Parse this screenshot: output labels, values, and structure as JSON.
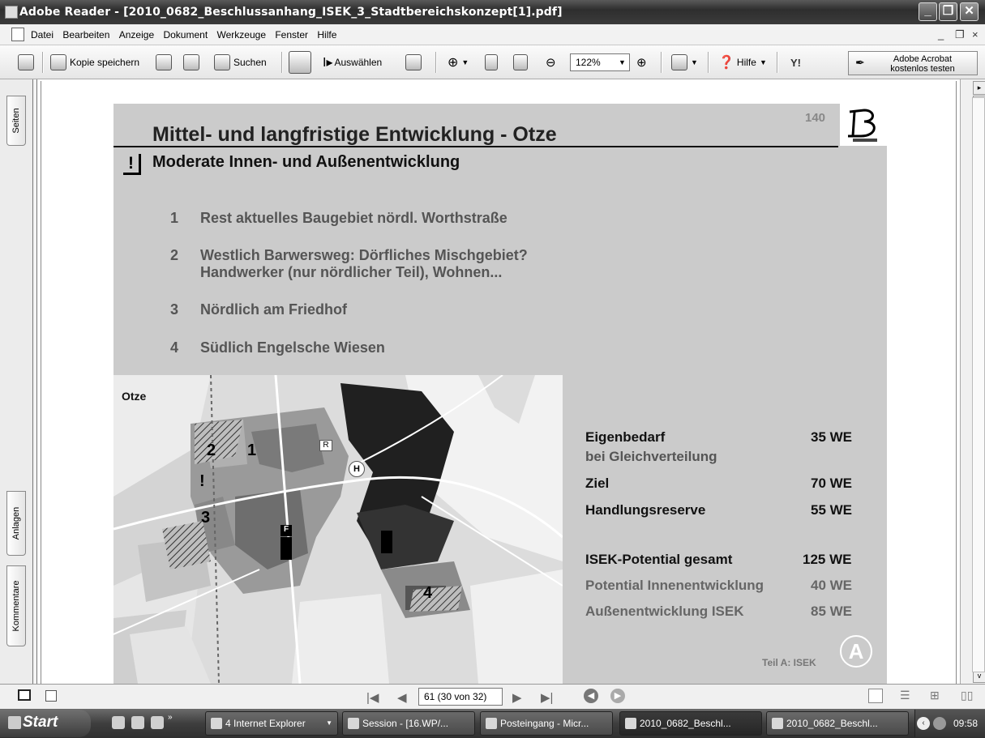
{
  "window": {
    "title": "Adobe Reader - [2010_0682_Beschlussanhang_ISEK_3_Stadtbereichskonzept[1].pdf]",
    "controls": [
      "_",
      "❐",
      "✕"
    ]
  },
  "menubar": {
    "items": [
      "Datei",
      "Bearbeiten",
      "Anzeige",
      "Dokument",
      "Werkzeuge",
      "Fenster",
      "Hilfe"
    ],
    "doc_controls": [
      "_",
      "❐",
      "×"
    ]
  },
  "toolbar": {
    "save_copy_label": "Kopie speichern",
    "search_label": "Suchen",
    "select_label": "Auswählen",
    "zoom_value": "122%",
    "help_label": "Hilfe",
    "yahoo_label": "Y!",
    "acrobat_line1": "Adobe Acrobat",
    "acrobat_line2": "kostenlos testen"
  },
  "left_panel": {
    "tabs": [
      "Seiten",
      "Anlagen",
      "Kommentare"
    ]
  },
  "slide": {
    "page_number": "140",
    "title": "Mittel- und langfristige Entwicklung - Otze",
    "exclamation": "!",
    "subtitle": "Moderate Innen- und Außenentwicklung",
    "items": [
      {
        "num": "1",
        "line1": "Rest aktuelles Baugebiet nördl. Worthstraße",
        "line2": ""
      },
      {
        "num": "2",
        "line1": "Westlich Barwersweg: Dörfliches Mischgebiet?",
        "line2": "Handwerker (nur nördlicher Teil), Wohnen..."
      },
      {
        "num": "3",
        "line1": "Nördlich am Friedhof",
        "line2": ""
      },
      {
        "num": "4",
        "line1": "Südlich Engelsche Wiesen",
        "line2": ""
      }
    ],
    "map": {
      "label": "Otze",
      "markers": [
        "1",
        "2",
        "3",
        "4",
        "!"
      ],
      "symbols": [
        "R",
        "H",
        "F"
      ]
    },
    "stats": [
      {
        "label": "Eigenbedarf",
        "sublabel": "bei Gleichverteilung",
        "value": "35 WE"
      },
      {
        "label": "Ziel",
        "sublabel": "",
        "value": "70 WE"
      },
      {
        "label": "Handlungsreserve",
        "sublabel": "",
        "value": "55 WE"
      },
      {
        "label": "ISEK-Potential gesamt",
        "sublabel": "",
        "value": "125 WE"
      },
      {
        "label": "Potential Innenentwicklung",
        "sublabel": "",
        "value": "40 WE"
      },
      {
        "label": "Außenentwicklung ISEK",
        "sublabel": "",
        "value": "85 WE"
      }
    ],
    "footer": "Teil A: ISEK"
  },
  "statusbar": {
    "page_box": "61 (30 von 32)"
  },
  "taskbar": {
    "start_label": "Start",
    "tasks": [
      {
        "label": "4 Internet Explorer"
      },
      {
        "label": "Session - [16.WP/..."
      },
      {
        "label": "Posteingang - Micr..."
      },
      {
        "label": "2010_0682_Beschl..."
      },
      {
        "label": "2010_0682_Beschl..."
      }
    ],
    "clock": "09:58"
  }
}
